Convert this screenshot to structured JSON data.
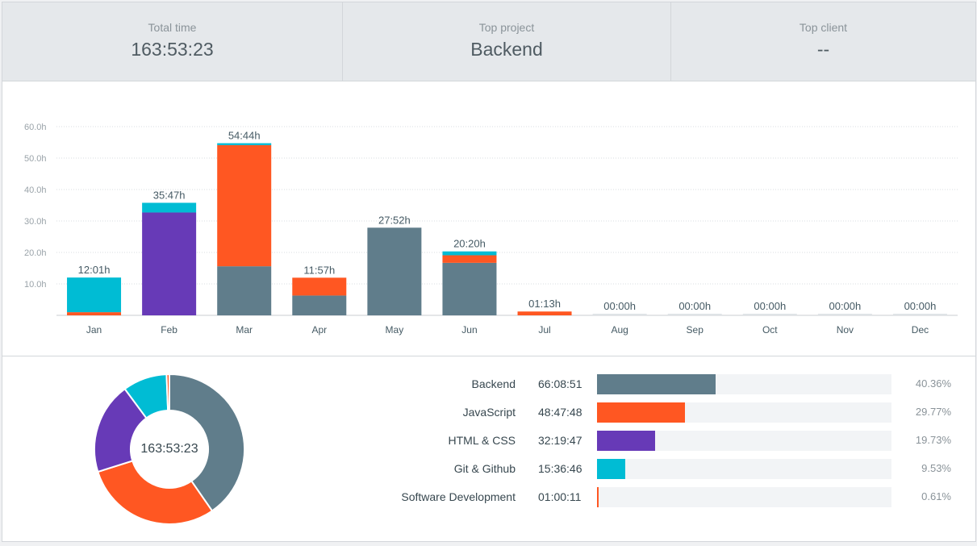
{
  "summary": [
    {
      "label": "Total time",
      "value": "163:53:23"
    },
    {
      "label": "Top project",
      "value": "Backend"
    },
    {
      "label": "Top client",
      "value": "--"
    }
  ],
  "colors": {
    "Backend": "#607d8b",
    "JavaScript": "#ff5722",
    "HTML & CSS": "#673ab7",
    "Git & Github": "#00bcd4",
    "Software Development": "#ff5722"
  },
  "chart_data": {
    "type": "bar",
    "stacked": true,
    "categories": [
      "Jan",
      "Feb",
      "Mar",
      "Apr",
      "May",
      "Jun",
      "Jul",
      "Aug",
      "Sep",
      "Oct",
      "Nov",
      "Dec"
    ],
    "y_tick_labels": [
      "60.0h",
      "50.0h",
      "40.0h",
      "30.0h",
      "20.0h",
      "10.0h"
    ],
    "ylim": [
      0,
      60
    ],
    "grid": true,
    "total_labels": [
      "12:01h",
      "35:47h",
      "54:44h",
      "11:57h",
      "27:52h",
      "20:20h",
      "01:13h",
      "00:00h",
      "00:00h",
      "00:00h",
      "00:00h",
      "00:00h"
    ],
    "series": [
      {
        "name": "Backend",
        "color": "#607d8b",
        "values": [
          0,
          0,
          15.6,
          6.3,
          27.87,
          16.7,
          0,
          0,
          0,
          0,
          0,
          0
        ]
      },
      {
        "name": "JavaScript",
        "color": "#ff5722",
        "values": [
          1.0,
          0,
          38.5,
          5.67,
          0,
          2.4,
          1.22,
          0,
          0,
          0,
          0,
          0
        ]
      },
      {
        "name": "HTML & CSS",
        "color": "#673ab7",
        "values": [
          0,
          32.7,
          0,
          0,
          0,
          0,
          0,
          0,
          0,
          0,
          0,
          0
        ]
      },
      {
        "name": "Git & Github",
        "color": "#00bcd4",
        "values": [
          11.02,
          3.08,
          0.63,
          0,
          0,
          1.23,
          0,
          0,
          0,
          0,
          0,
          0
        ]
      }
    ]
  },
  "donut": {
    "center_label": "163:53:23",
    "slices": [
      {
        "name": "Backend",
        "percent": 40.36,
        "color": "#607d8b"
      },
      {
        "name": "JavaScript",
        "percent": 29.77,
        "color": "#ff5722"
      },
      {
        "name": "HTML & CSS",
        "percent": 19.73,
        "color": "#673ab7"
      },
      {
        "name": "Git & Github",
        "percent": 9.53,
        "color": "#00bcd4"
      },
      {
        "name": "Software Development",
        "percent": 0.61,
        "color": "#ff5722"
      }
    ]
  },
  "projects": [
    {
      "name": "Backend",
      "time": "66:08:51",
      "percent": "40.36%",
      "fraction": 0.4036,
      "color": "#607d8b"
    },
    {
      "name": "JavaScript",
      "time": "48:47:48",
      "percent": "29.77%",
      "fraction": 0.2977,
      "color": "#ff5722"
    },
    {
      "name": "HTML & CSS",
      "time": "32:19:47",
      "percent": "19.73%",
      "fraction": 0.1973,
      "color": "#673ab7"
    },
    {
      "name": "Git & Github",
      "time": "15:36:46",
      "percent": "9.53%",
      "fraction": 0.0953,
      "color": "#00bcd4"
    },
    {
      "name": "Software Development",
      "time": "01:00:11",
      "percent": "0.61%",
      "fraction": 0.0061,
      "color": "#ff5722"
    }
  ]
}
